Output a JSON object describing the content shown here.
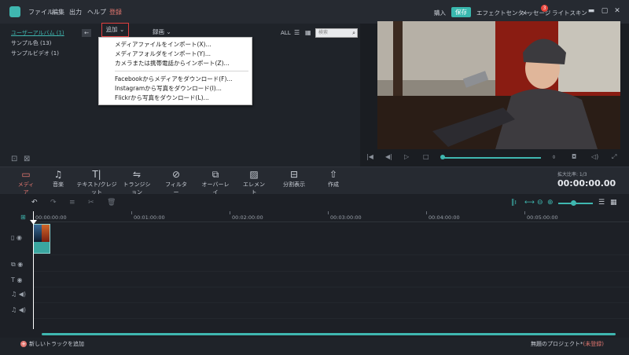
{
  "titlebar": {
    "menu": [
      "ファイル",
      "編集",
      "出力",
      "ヘルプ",
      "登録"
    ],
    "buy": "購入",
    "save": "保存",
    "effect_center": "エフェクトセンター",
    "messages": "メッセージ",
    "message_badge": "3",
    "light_skin": "ライトスキン",
    "accent": "#39b8ae",
    "register_color": "#e2766f"
  },
  "library": {
    "albums": [
      "ユーザーアルバム (1)",
      "サンプル色 (13)",
      "サンプルビデオ (1)"
    ],
    "add_label": "追加",
    "record_label": "録画",
    "all_label": "ALL",
    "search_placeholder": "検索"
  },
  "dropdown": {
    "items": [
      "メディアファイルをインポート(X)...",
      "メディアフォルダをインポート(Y)...",
      "カメラまたは携帯電話からインポート(Z)...",
      "Facebookからメディアをダウンロード(F)...",
      "Instagramから写真をダウンロード(I)...",
      "Flickrから写真をダウンロード(L)..."
    ]
  },
  "toolbar": {
    "tools": [
      "メディア",
      "音楽",
      "テキスト/クレジット",
      "トランジション",
      "フィルター",
      "オーバーレイ",
      "エレメント",
      "分割表示",
      "作成"
    ],
    "zoom_label": "拡大比率: 1/3",
    "timecode": "00:00:00.00"
  },
  "timeline": {
    "ticks": [
      "00:00:00:00",
      "00:01:00:00",
      "00:02:00:00",
      "00:03:00:00",
      "00:04:00:00",
      "00:05:00:00"
    ],
    "add_track": "新しいトラックを追加",
    "project_name": "無題のプロジェクト*",
    "unregistered": "(未登録)"
  }
}
